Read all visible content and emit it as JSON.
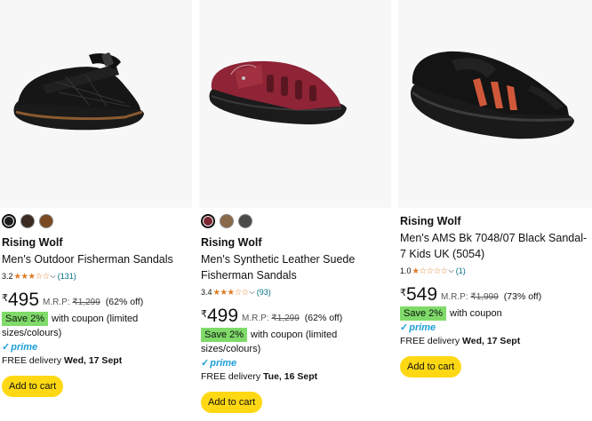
{
  "products": [
    {
      "brand": "Rising Wolf",
      "title": "Men's Outdoor Fisherman Sandals",
      "rating": "3.2",
      "stars_full": "★★★",
      "stars_empty": "☆☆",
      "review_count": "(131)",
      "price_symbol": "₹",
      "price": "495",
      "mrp_label": "M.R.P:",
      "mrp": "₹1,299",
      "discount": "(62% off)",
      "coupon_badge": "Save 2%",
      "coupon_text": "with coupon (limited sizes/colours)",
      "prime_check": "✓",
      "prime_label": "prime",
      "delivery_label": "FREE delivery",
      "delivery_date": "Wed, 17 Sept",
      "cart_label": "Add to cart",
      "swatches": [
        "#1c1c1c",
        "#3a2a22",
        "#7a4a22"
      ],
      "image_icon": "black-fisherman-sandal"
    },
    {
      "brand": "Rising Wolf",
      "title": "Men's Synthetic Leather Suede Fisherman Sandals",
      "rating": "3.4",
      "stars_full": "★★★",
      "stars_empty": "☆☆",
      "review_count": "(93)",
      "price_symbol": "₹",
      "price": "499",
      "mrp_label": "M.R.P:",
      "mrp": "₹1,299",
      "discount": "(62% off)",
      "coupon_badge": "Save 2%",
      "coupon_text": "with coupon (limited sizes/colours)",
      "prime_check": "✓",
      "prime_label": "prime",
      "delivery_label": "FREE delivery",
      "delivery_date": "Tue, 16 Sept",
      "cart_label": "Add to cart",
      "swatches": [
        "#7a2630",
        "#8a6a4a",
        "#4a4a48"
      ],
      "image_icon": "maroon-fisherman-sandal"
    },
    {
      "brand": "Rising Wolf",
      "title": "Men's AMS Bk 7048/07 Black Sandal-7 Kids UK (5054)",
      "rating": "1.0",
      "stars_full": "★",
      "stars_empty": "☆☆☆☆",
      "review_count": "(1)",
      "price_symbol": "₹",
      "price": "549",
      "mrp_label": "M.R.P:",
      "mrp": "₹1,999",
      "discount": "(73% off)",
      "coupon_badge": "Save 2%",
      "coupon_text": "with coupon",
      "prime_check": "✓",
      "prime_label": "prime",
      "delivery_label": "FREE delivery",
      "delivery_date": "Wed, 17 Sept",
      "cart_label": "Add to cart",
      "image_icon": "black-sandal-orange-straps"
    }
  ],
  "colors": {
    "cart_button": "#ffd814",
    "coupon_badge": "#7fda69",
    "star": "#de7921",
    "link": "#007185",
    "prime": "#1d9fd8"
  }
}
